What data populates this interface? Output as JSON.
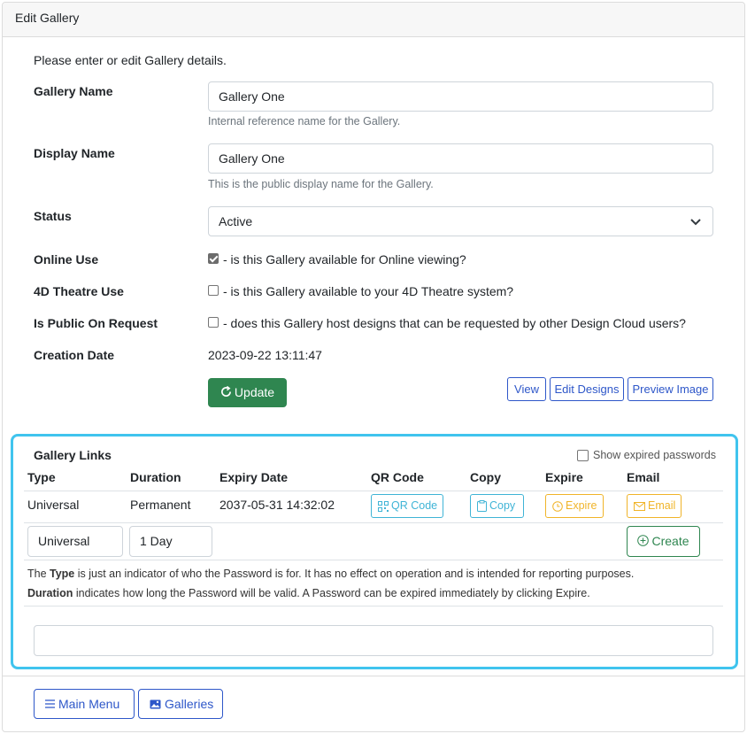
{
  "header": {
    "title": "Edit Gallery"
  },
  "intro": "Please enter or edit Gallery details.",
  "form": {
    "gallery_name": {
      "label": "Gallery Name",
      "value": "Gallery One",
      "help": "Internal reference name for the Gallery."
    },
    "display_name": {
      "label": "Display Name",
      "value": "Gallery One",
      "help": "This is the public display name for the Gallery."
    },
    "status": {
      "label": "Status",
      "value": "Active"
    },
    "online_use": {
      "label": "Online Use",
      "checked": true,
      "text": "- is this Gallery available for Online viewing?"
    },
    "theatre_use": {
      "label": "4D Theatre Use",
      "checked": false,
      "text": "- is this Gallery available to your 4D Theatre system?"
    },
    "public_request": {
      "label": "Is Public On Request",
      "checked": false,
      "text": "- does this Gallery host designs that can be requested by other Design Cloud users?"
    },
    "creation_date": {
      "label": "Creation Date",
      "value": "2023-09-22 13:11:47"
    }
  },
  "actions": {
    "update": "Update",
    "view": "View",
    "edit_designs": "Edit Designs",
    "preview_image": "Preview Image"
  },
  "links": {
    "title": "Gallery Links",
    "show_expired_label": "Show expired passwords",
    "columns": [
      "Type",
      "Duration",
      "Expiry Date",
      "QR Code",
      "Copy",
      "Expire",
      "Email"
    ],
    "row": {
      "type": "Universal",
      "duration": "Permanent",
      "expiry": "2037-05-31 14:32:02",
      "qr": "QR Code",
      "copy": "Copy",
      "expire": "Expire",
      "email": "Email"
    },
    "new": {
      "type": "Universal",
      "duration": "1 Day",
      "create": "Create"
    },
    "note1_bold": "The ",
    "note1_type": "Type",
    "note1_rest": " is just an indicator of who the Password is for. It has no effect on operation and is intended for reporting purposes.",
    "note2_bold": "Duration",
    "note2_rest": " indicates how long the Password will be valid. A Password can be expired immediately by clicking Expire."
  },
  "footer": {
    "main_menu": "Main Menu",
    "galleries": "Galleries"
  },
  "colors": {
    "primary": "#2e57c9",
    "success": "#2f8650",
    "info": "#3fb4d6",
    "warning": "#f0b429",
    "highlight": "#40c4ee"
  }
}
